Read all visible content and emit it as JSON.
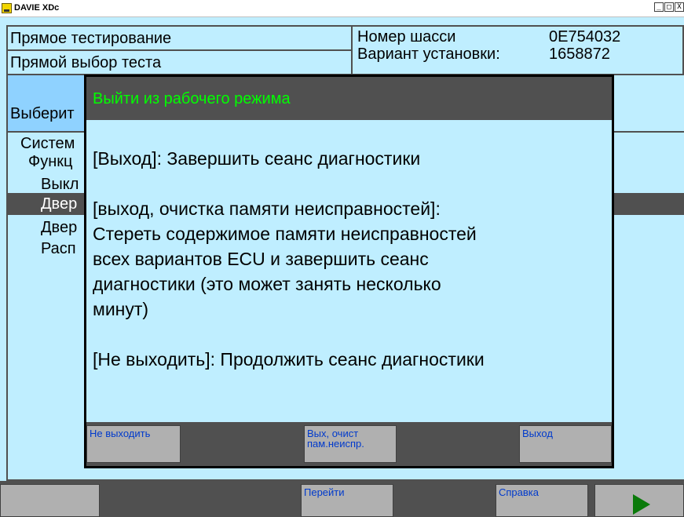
{
  "window": {
    "title": "DAVIE XDc",
    "buttons": [
      "_",
      "□",
      "X"
    ]
  },
  "header": {
    "direct_testing": "Прямое тестирование",
    "direct_test_select": "Прямой выбор теста",
    "choose_partial": "Выберит",
    "chassis_label": "Номер шасси",
    "chassis_value": "0E754032",
    "variant_label": "Вариант установки:",
    "variant_value": "1658872"
  },
  "tree": {
    "items": [
      "Систем",
      "Функц",
      "Выкл",
      "Двер",
      "Двер",
      "Расп"
    ],
    "selected_index": 3
  },
  "bottom_bar": {
    "go_label": "Перейти",
    "help_label": "Справка",
    "next_icon": "play-triangle-icon"
  },
  "dialog": {
    "title": "Выйти из рабочего режима",
    "para1": "[Выход]: Завершить сеанс диагностики",
    "para2_line1": "[выход, очистка памяти неисправностей]:",
    "para2_line2": "Стереть содержимое памяти неисправностей",
    "para2_line3": "всех вариантов ECU и завершить сеанс",
    "para2_line4": "диагностики (это может занять несколько",
    "para2_line5": "минут)",
    "para3": "[Не выходить]: Продолжить сеанс диагностики",
    "btn_stay": "Не выходить",
    "btn_exit_clear_line1": "Вых, очист",
    "btn_exit_clear_line2": "пам.неиспр.",
    "btn_exit": "Выход"
  },
  "colors": {
    "panel_bg": "#bfeeff",
    "highlight_bg": "#8fd2ff",
    "dark_bar": "#505050",
    "button_bg": "#b0b0b0",
    "button_text": "#003acc",
    "dialog_title": "#00ff00",
    "play_icon": "#0a7a0a"
  }
}
